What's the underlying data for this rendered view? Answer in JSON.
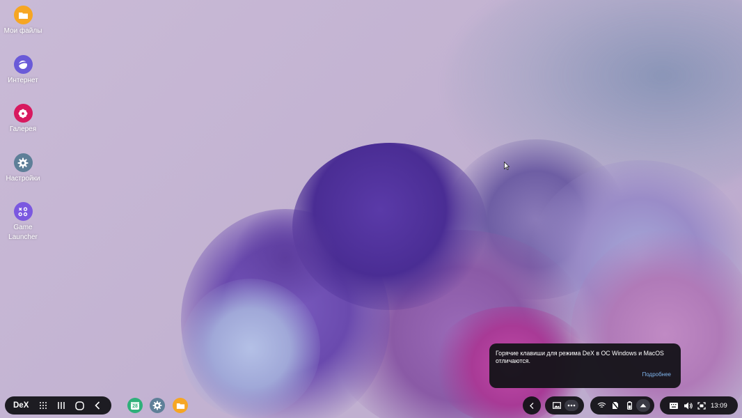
{
  "desktop": {
    "icons": [
      {
        "label": "Мои файлы",
        "icon": "folder-icon",
        "color": "#f6a623"
      },
      {
        "label": "Интернет",
        "icon": "browser-icon",
        "color": "#6a5ad8"
      },
      {
        "label": "Галерея",
        "icon": "gallery-flower-icon",
        "color": "#d8195f"
      },
      {
        "label": "Настройки",
        "icon": "gear-icon",
        "color": "#5e7f98"
      },
      {
        "label": "Game\nLauncher",
        "icon": "game-launcher-icon",
        "color": "#7b58e0"
      }
    ]
  },
  "toast": {
    "message": "Горячие клавиши для режима DeX в ОС Windows и MacOS отличаются.",
    "action": "Подробнее"
  },
  "taskbar": {
    "dex_label": "DeX",
    "nav": [
      "apps-grid-icon",
      "recents-icon",
      "home-icon",
      "back-icon"
    ],
    "apps": [
      {
        "name": "calendar",
        "icon": "calendar-icon",
        "label": "28",
        "color": "#2fb07a"
      },
      {
        "name": "settings",
        "icon": "gear-icon",
        "color": "#5e7f98"
      },
      {
        "name": "files",
        "icon": "folder-icon",
        "color": "#f6a623"
      }
    ],
    "tray": {
      "clock": "13:09",
      "icons": [
        "wifi-icon",
        "no-sim-icon",
        "battery-icon",
        "up-arrow-icon",
        "keyboard-icon",
        "volume-icon",
        "screenshot-icon"
      ]
    }
  }
}
